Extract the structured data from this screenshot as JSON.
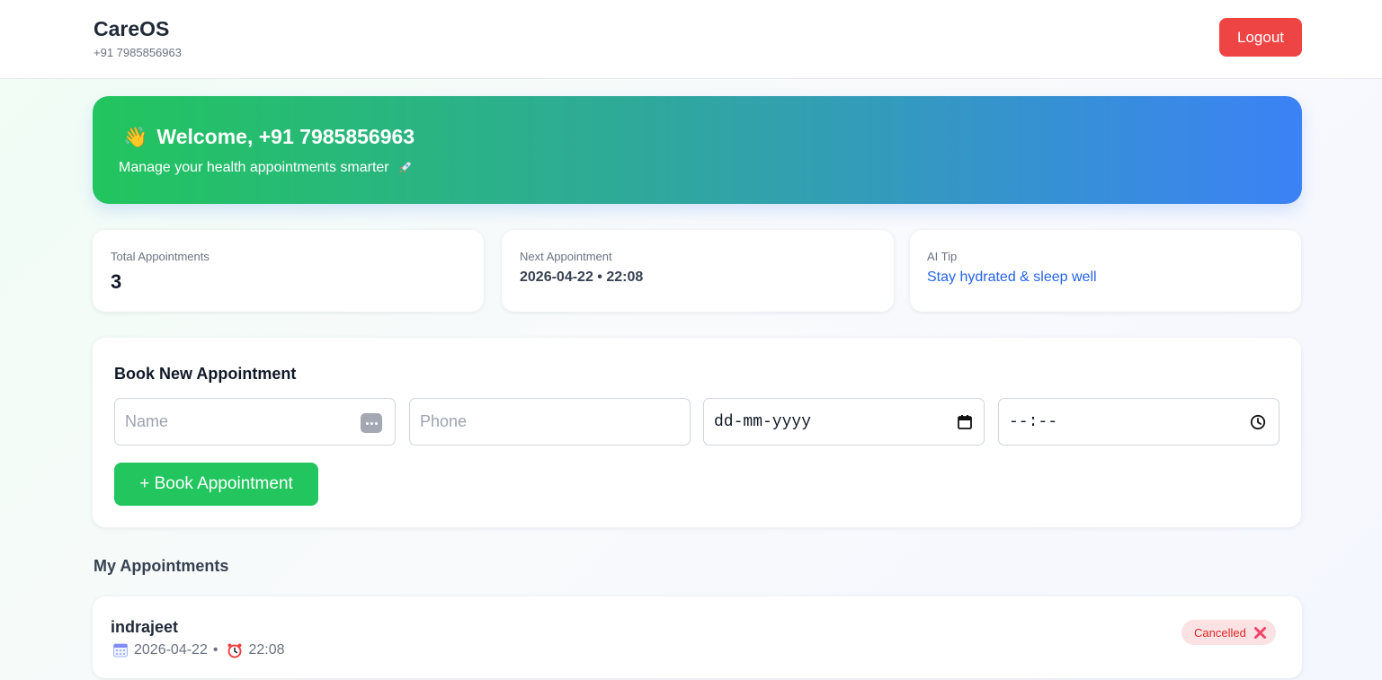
{
  "header": {
    "brand": "CareOS",
    "phone": "+91 7985856963",
    "logout_label": "Logout",
    "logout_color": "#ef4444"
  },
  "hero": {
    "title": "Welcome, +91 7985856963",
    "wave_icon": "waving-hand-icon",
    "subtitle": "Manage your health appointments smarter",
    "rocket_icon": "rocket-icon",
    "gradient_start": "#22c55e",
    "gradient_end": "#3b82f6"
  },
  "stats": {
    "total": {
      "label": "Total Appointments",
      "value": "3"
    },
    "next": {
      "label": "Next Appointment",
      "value": "2026-04-22 • 22:08"
    },
    "tip": {
      "label": "AI Tip",
      "value": "Stay hydrated & sleep well"
    }
  },
  "booking": {
    "title": "Book New Appointment",
    "name_placeholder": "Name",
    "phone_placeholder": "Phone",
    "date_placeholder": "dd-mm-yyyy",
    "time_placeholder": "--:--",
    "submit_label": "+ Book Appointment",
    "submit_color": "#22c55e"
  },
  "appointments": {
    "title": "My Appointments",
    "items": [
      {
        "name": "indrajeet",
        "date": "2026-04-22",
        "separator": "•",
        "time": "22:08",
        "status": "Cancelled",
        "status_icon": "cross-mark-icon"
      }
    ]
  }
}
